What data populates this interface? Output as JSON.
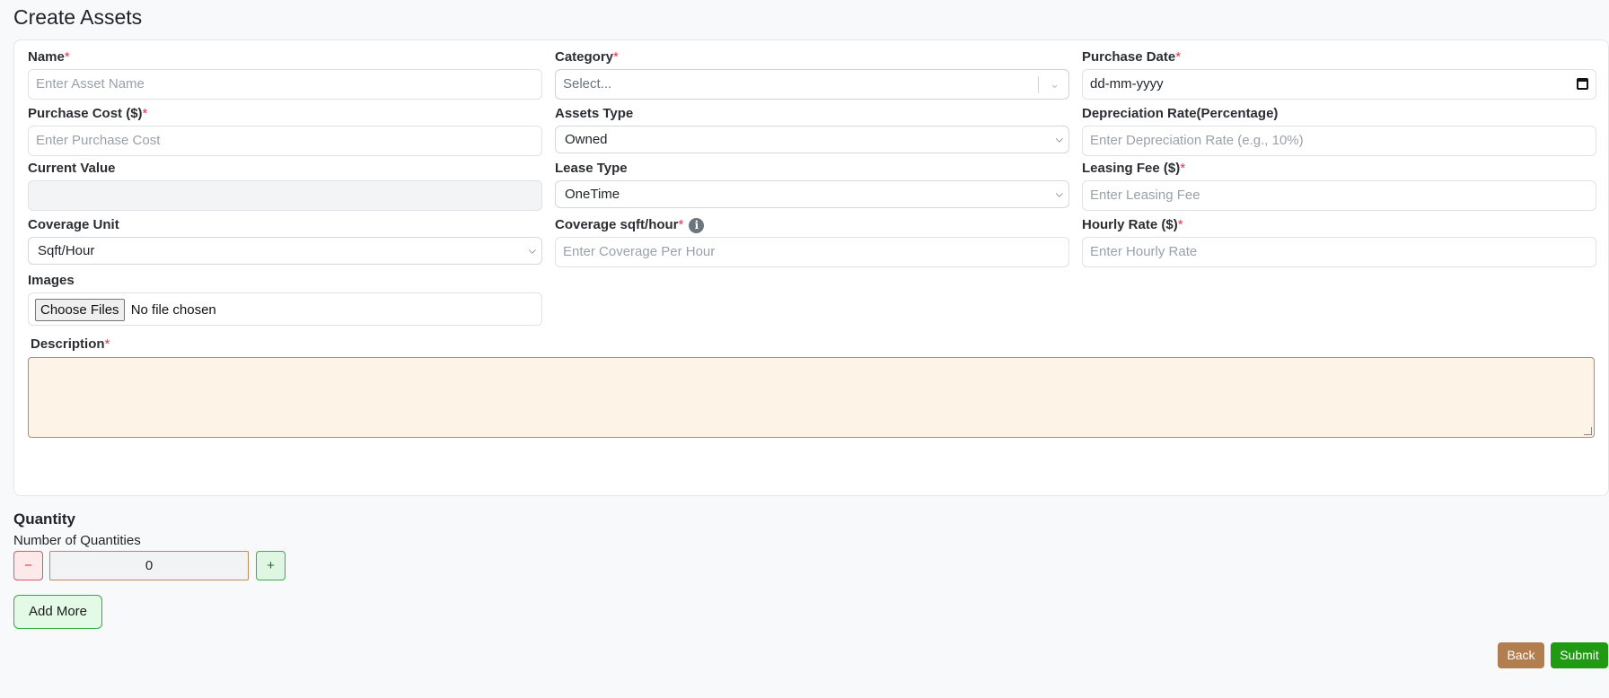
{
  "page": {
    "title": "Create Assets"
  },
  "form": {
    "name": {
      "label": "Name",
      "required": "*",
      "placeholder": "Enter Asset Name"
    },
    "category": {
      "label": "Category",
      "required": "*",
      "placeholder": "Select..."
    },
    "purchase_date": {
      "label": "Purchase Date",
      "required": "*",
      "value": "dd-mm-yyyy"
    },
    "purchase_cost": {
      "label": "Purchase Cost ($)",
      "required": "*",
      "placeholder": "Enter Purchase Cost"
    },
    "assets_type": {
      "label": "Assets Type",
      "value": "Owned"
    },
    "depreciation_rate": {
      "label": "Depreciation Rate(Percentage)",
      "placeholder": "Enter Depreciation Rate (e.g., 10%)"
    },
    "current_value": {
      "label": "Current Value",
      "value": ""
    },
    "lease_type": {
      "label": "Lease Type",
      "value": "OneTime"
    },
    "leasing_fee": {
      "label": "Leasing Fee ($)",
      "required": "*",
      "placeholder": "Enter Leasing Fee"
    },
    "coverage_unit": {
      "label": "Coverage Unit",
      "value": "Sqft/Hour"
    },
    "coverage_per_hour": {
      "label": "Coverage sqft/hour",
      "required": "*",
      "placeholder": "Enter Coverage Per Hour",
      "info_icon": "i"
    },
    "hourly_rate": {
      "label": "Hourly Rate ($)",
      "required": "*",
      "placeholder": "Enter Hourly Rate"
    },
    "images": {
      "label": "Images",
      "button": "Choose Files",
      "status": "No file chosen"
    },
    "description": {
      "label": "Description",
      "required": "*",
      "value": ""
    }
  },
  "quantity": {
    "title": "Quantity",
    "label": "Number of Quantities",
    "minus": "−",
    "value": "0",
    "plus": "+",
    "add_more": "Add More"
  },
  "actions": {
    "back": "Back",
    "submit": "Submit"
  },
  "colors": {
    "required": "#e0334a",
    "back": "#b37e4f",
    "submit": "#1f9a12",
    "add_more_border": "#2fae3d",
    "description_bg": "#fdf3e7"
  },
  "icons": {
    "info": "info-icon",
    "calendar": "calendar-icon",
    "chevron": "chevron-down-icon"
  }
}
